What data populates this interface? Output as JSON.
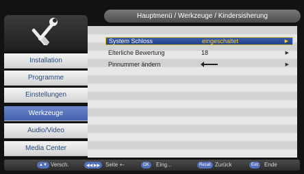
{
  "header": {
    "breadcrumb": "Hauptmenü / Werkzeuge / Kindersisherung"
  },
  "sidebar": {
    "logo_icon": "tools-icon",
    "items": [
      {
        "label": "Installation",
        "active": false
      },
      {
        "label": "Programme",
        "active": false
      },
      {
        "label": "Einstellungen",
        "active": false
      },
      {
        "label": "Werkzeuge",
        "active": true
      },
      {
        "label": "Audio/Video",
        "active": false
      },
      {
        "label": "Media Center",
        "active": false
      }
    ]
  },
  "settings": [
    {
      "label": "System Schloss",
      "value": "eingeschaltet",
      "selected": true
    },
    {
      "label": "Elterliche Bewertung",
      "value": "18",
      "selected": false
    },
    {
      "label": "Pinnummer ändern",
      "value": "",
      "icon": "left-arrow-icon",
      "selected": false
    }
  ],
  "footer": {
    "keys": [
      {
        "key": "▲▼",
        "label": "Versch."
      },
      {
        "key": "◀◀ ▶▶",
        "label": "Seite +-"
      },
      {
        "key": "OK",
        "label": "Eing..."
      },
      {
        "key": "Recall",
        "label": "Zurück"
      },
      {
        "key": "Exit",
        "label": "Ende"
      }
    ]
  },
  "colors": {
    "active_menu": "#4462ad",
    "highlight_text": "#f0d040",
    "title_bar": "#5a5a5a"
  }
}
